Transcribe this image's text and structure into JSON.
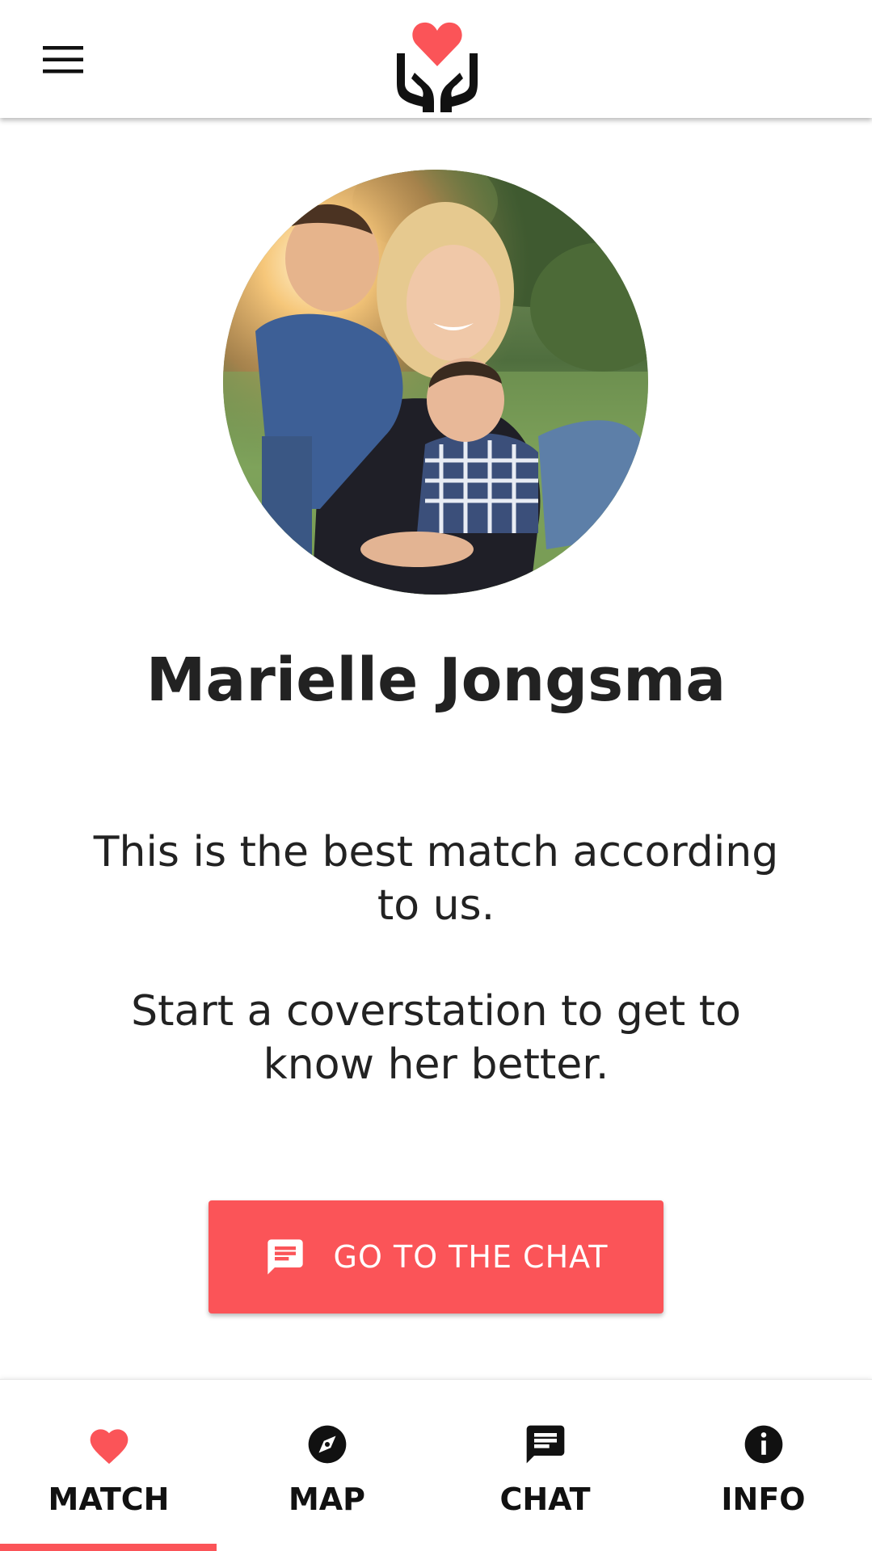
{
  "header": {
    "menu_icon": "hamburger-menu-icon",
    "logo_icon": "heart-in-hands-logo"
  },
  "profile": {
    "name": "Marielle Jongsma",
    "photo": "profile-photo-mother-with-two-children",
    "message_line1": "This is the best match according to us.",
    "message_line2": "Start a coverstation to get to know her better."
  },
  "chat_button": {
    "label": "GO TO THE CHAT",
    "icon": "chat-bubble-icon"
  },
  "bottom_nav": {
    "items": [
      {
        "label": "MATCH",
        "icon": "heart-icon",
        "active": true
      },
      {
        "label": "MAP",
        "icon": "compass-icon",
        "active": false
      },
      {
        "label": "CHAT",
        "icon": "chat-icon",
        "active": false
      },
      {
        "label": "INFO",
        "icon": "info-icon",
        "active": false
      }
    ]
  },
  "colors": {
    "accent": "#fb5458",
    "text": "#222222",
    "background": "#ffffff"
  }
}
